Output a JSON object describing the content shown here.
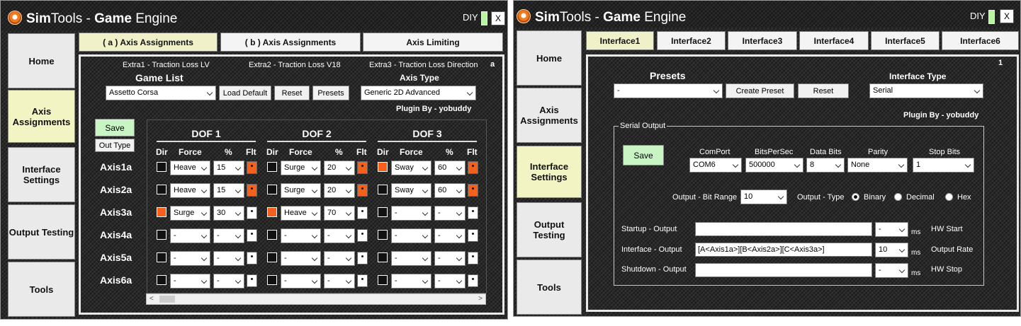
{
  "window1": {
    "title_sim": "Sim",
    "title_tools": "Tools - ",
    "title_game": "Game",
    "title_engine": " Engine",
    "diy": "DIY",
    "close": "X",
    "nav": [
      "Home",
      "Axis Assignments",
      "Interface Settings",
      "Output Testing",
      "Tools"
    ],
    "tabs": [
      "( a ) Axis Assignments",
      "( b ) Axis Assignments",
      "Axis Limiting"
    ],
    "corner": "a",
    "extras": [
      "Extra1 - Traction Loss LV",
      "Extra2 - Traction Loss V18",
      "Extra3 - Traction Loss Direction"
    ],
    "game_list_label": "Game List",
    "game_value": "Assetto Corsa",
    "load_default": "Load Default",
    "reset": "Reset",
    "presets": "Presets",
    "axis_type_label": "Axis Type",
    "axis_type_value": "Generic 2D Advanced",
    "plugin_by": "Plugin By - yobuddy",
    "save": "Save",
    "out_type": "Out Type",
    "dof": [
      "DOF 1",
      "DOF 2",
      "DOF 3"
    ],
    "col_dir": "Dir",
    "col_force": "Force",
    "col_pct": "%",
    "col_flt": "Flt",
    "axes": [
      {
        "label": "Axis1a",
        "cells": [
          {
            "dir": false,
            "force": "Heave",
            "pct": "15",
            "flt": true
          },
          {
            "dir": false,
            "force": "Surge",
            "pct": "20",
            "flt": true
          },
          {
            "dir": true,
            "force": "Sway",
            "pct": "60",
            "flt": true
          }
        ]
      },
      {
        "label": "Axis2a",
        "cells": [
          {
            "dir": false,
            "force": "Heave",
            "pct": "15",
            "flt": true
          },
          {
            "dir": false,
            "force": "Surge",
            "pct": "20",
            "flt": true
          },
          {
            "dir": false,
            "force": "Sway",
            "pct": "60",
            "flt": true
          }
        ]
      },
      {
        "label": "Axis3a",
        "cells": [
          {
            "dir": true,
            "force": "Surge",
            "pct": "30",
            "flt": false
          },
          {
            "dir": true,
            "force": "Heave",
            "pct": "70",
            "flt": false
          },
          {
            "dir": false,
            "force": "-",
            "pct": "-",
            "flt": false
          }
        ]
      },
      {
        "label": "Axis4a",
        "cells": [
          {
            "dir": false,
            "force": "-",
            "pct": "-",
            "flt": false
          },
          {
            "dir": false,
            "force": "-",
            "pct": "-",
            "flt": false
          },
          {
            "dir": false,
            "force": "-",
            "pct": "-",
            "flt": false
          }
        ]
      },
      {
        "label": "Axis5a",
        "cells": [
          {
            "dir": false,
            "force": "-",
            "pct": "-",
            "flt": false
          },
          {
            "dir": false,
            "force": "-",
            "pct": "-",
            "flt": false
          },
          {
            "dir": false,
            "force": "-",
            "pct": "-",
            "flt": false
          }
        ]
      },
      {
        "label": "Axis6a",
        "cells": [
          {
            "dir": false,
            "force": "-",
            "pct": "-",
            "flt": false
          },
          {
            "dir": false,
            "force": "-",
            "pct": "-",
            "flt": false
          },
          {
            "dir": false,
            "force": "-",
            "pct": "-",
            "flt": false
          }
        ]
      }
    ],
    "scroll_left": "<",
    "scroll_right": ">"
  },
  "window2": {
    "title_sim": "Sim",
    "title_tools": "Tools - ",
    "title_game": "Game",
    "title_engine": " Engine",
    "diy": "DIY",
    "close": "X",
    "nav": [
      "Home",
      "Axis Assignments",
      "Interface Settings",
      "Output Testing",
      "Tools"
    ],
    "tabs": [
      "Interface1",
      "Interface2",
      "Interface3",
      "Interface4",
      "Interface5",
      "Interface6"
    ],
    "corner": "1",
    "presets_label": "Presets",
    "presets_value": "-",
    "create_preset": "Create Preset",
    "reset": "Reset",
    "interface_type_label": "Interface Type",
    "interface_type_value": "Serial",
    "plugin_by": "Plugin By - yobuddy",
    "group_label": "Serial Output",
    "save": "Save",
    "comport_label": "ComPort",
    "comport_value": "COM6",
    "bps_label": "BitsPerSec",
    "bps_value": "500000",
    "databits_label": "Data Bits",
    "databits_value": "8",
    "parity_label": "Parity",
    "parity_value": "None",
    "stopbits_label": "Stop Bits",
    "stopbits_value": "1",
    "bit_range_label": "Output - Bit Range",
    "bit_range_value": "10",
    "out_type_label": "Output - Type",
    "radio_binary": "Binary",
    "radio_decimal": "Decimal",
    "radio_hex": "Hex",
    "startup_label": "Startup - Output",
    "startup_value": "",
    "startup_ms": "-",
    "interface_label": "Interface - Output",
    "interface_value": "[A<Axis1a>][B<Axis2a>][C<Axis3a>]",
    "interface_ms": "10",
    "shutdown_label": "Shutdown - Output",
    "shutdown_value": "",
    "shutdown_ms": "-",
    "ms": "ms",
    "hw_start": "HW Start",
    "output_rate": "Output Rate",
    "hw_stop": "HW Stop"
  }
}
